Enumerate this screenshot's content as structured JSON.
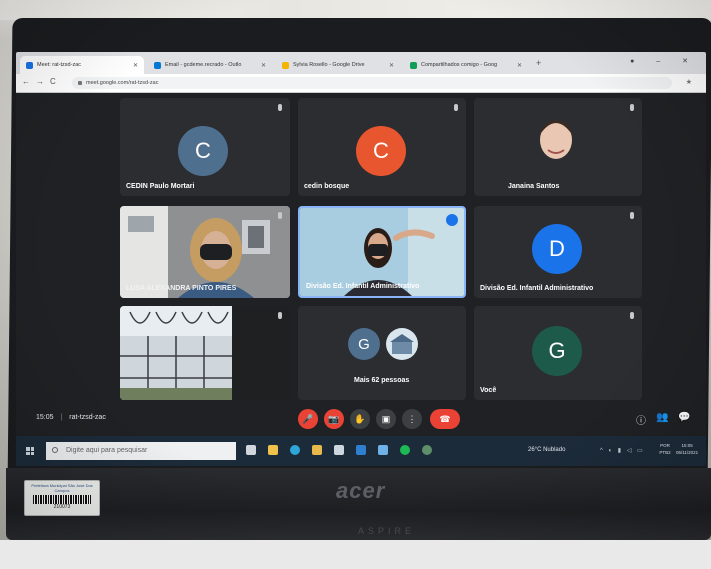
{
  "browser": {
    "tabs": [
      {
        "label": "Meet: rat-tzsd-zac",
        "icon_color": "#1a73e8"
      },
      {
        "label": "Email - gcdeme.recrado - Outlo",
        "icon_color": "#0078d4"
      },
      {
        "label": "Sylvia Rosello - Google Drive",
        "icon_color": "#f4b400"
      },
      {
        "label": "Compartilhados comigo - Goog",
        "icon_color": "#0f9d58"
      }
    ],
    "url": "meet.google.com/rat-tzsd-zac"
  },
  "participants": [
    {
      "name": "CEDIN Paulo Mortari",
      "initial": "C",
      "color": "#4f6f8f"
    },
    {
      "name": "cedin bosque",
      "initial": "C",
      "color": "#e8562f"
    },
    {
      "name": "Janaina Santos",
      "initial": "",
      "color": "#3c4043"
    },
    {
      "name": "LUSA ALEXANDRA PINTO PIRES",
      "initial": "",
      "color": "#8a8b8c"
    },
    {
      "name": "Divisão Ed. Infantil Administrativo",
      "initial": "",
      "color": "#9cc3d9"
    },
    {
      "name": "Divisão Ed. Infantil Administrativo",
      "initial": "D",
      "color": "#1a73e8"
    },
    {
      "name": "",
      "initial": "",
      "color": "#b7c3c9"
    },
    {
      "name": "Mais 62 pessoas",
      "initial": "G",
      "color": "#4f6f8f"
    },
    {
      "name": "Você",
      "initial": "G",
      "color": "#1e5a4a"
    }
  ],
  "meeting": {
    "time": "15:05",
    "separator": "|",
    "code": "rat-tzsd-zac"
  },
  "controls": {
    "mic": "🎤",
    "cam": "📷",
    "hand": "✋",
    "present": "▣",
    "more": "⋮",
    "end": "☎",
    "info": "ⓘ",
    "people": "👥",
    "chat": "💬"
  },
  "taskbar": {
    "search_placeholder": "Digite aqui para pesquisar",
    "weather": "26°C Nublado",
    "lang": "POR PTB2",
    "time": "15:05",
    "date": "05/11/2021"
  },
  "laptop": {
    "brand": "acer",
    "model": "ASPIRE",
    "sticker_text": "Prefeitura Municipal São José Dos Campos",
    "sticker_number": "210073"
  }
}
